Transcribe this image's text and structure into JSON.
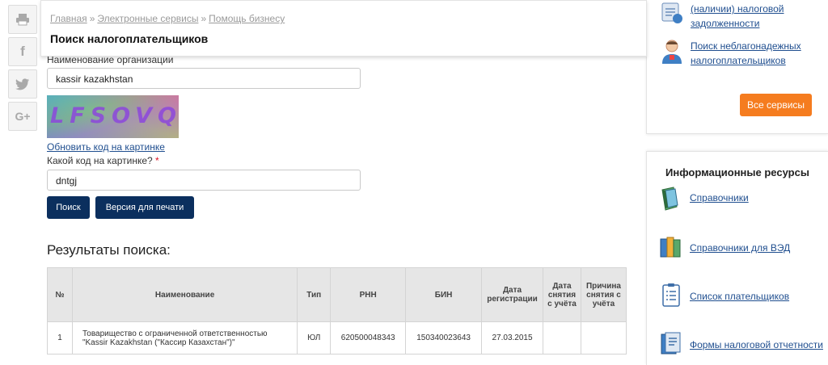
{
  "social": {
    "print_glyph": "⎙",
    "facebook_glyph": "f",
    "twitter_glyph": "🐦",
    "google_glyph": "G+"
  },
  "breadcrumb": {
    "items": [
      "Главная",
      "Электронные сервисы",
      "Помощь бизнесу"
    ],
    "separator": "»"
  },
  "page_title": "Поиск налогоплательщиков",
  "form": {
    "org_label": "Наименование организации",
    "org_value": "kassir kazakhstan",
    "captcha_text": "LFSOVQ",
    "refresh_label": "Обновить код на картинке",
    "code_label": "Какой код на картинке?",
    "required_mark": "*",
    "code_value": "dntgj",
    "search_button": "Поиск",
    "print_button": "Версия для печати"
  },
  "results": {
    "title": "Результаты поиска:",
    "columns": [
      "№",
      "Наименование",
      "Тип",
      "РНН",
      "БИН",
      "Дата регистрации",
      "Дата снятия с учёта",
      "Причина снятия с учёта"
    ],
    "rows": [
      {
        "num": "1",
        "name": "Товарищество с ограниченной ответственностью \"Kassir Kazakhstan (\"Кассир Казахстан\")\"",
        "type": "ЮЛ",
        "rnn": "620500048343",
        "bin": "150340023643",
        "reg_date": "27.03.2015",
        "dereg_date": "",
        "dereg_reason": ""
      }
    ]
  },
  "right": {
    "services": [
      {
        "label": "(наличии) налоговой задолженности",
        "icon": "debt-icon"
      },
      {
        "label": "Поиск неблагонадежных налогоплательщиков",
        "icon": "person-icon"
      }
    ],
    "all_services_button": "Все сервисы",
    "info_title": "Информационные ресурсы",
    "info_items": [
      {
        "label": "Справочники",
        "icon": "books-icon"
      },
      {
        "label": "Справочники для ВЭД",
        "icon": "binders-icon"
      },
      {
        "label": "Список плательщиков",
        "icon": "list-icon"
      },
      {
        "label": "Формы налоговой отчетности",
        "icon": "forms-icon"
      }
    ]
  },
  "colors": {
    "nav_button": "#0b2f5e",
    "orange_button": "#f57c1f",
    "link": "#1f4e8f"
  }
}
